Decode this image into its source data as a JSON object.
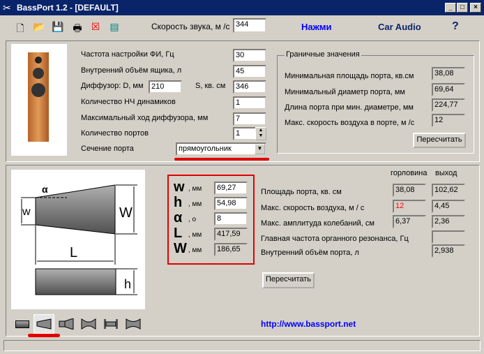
{
  "window": {
    "title": "BassPort 1.2 - [DEFAULT]"
  },
  "toolbar": {
    "sound_speed_label": "Скорость звука, м /с",
    "sound_speed_value": "344",
    "press_link": "Нажми",
    "car_audio_link": "Car Audio",
    "help": "?"
  },
  "top": {
    "rows": [
      {
        "label": "Частота настройки ФИ, Гц",
        "value": "30"
      },
      {
        "label": "Внутренний объём ящика, л",
        "value": "45"
      },
      {
        "label": "Диффузор: D, мм",
        "value": "346",
        "d_value": "210",
        "s_label": "S, кв. см"
      },
      {
        "label": "Количество НЧ динамиков",
        "value": "1"
      },
      {
        "label": "Максимальный ход диффузора, мм",
        "value": "7"
      },
      {
        "label": "Количество портов",
        "value": "1"
      }
    ],
    "section_label": "Сечение порта",
    "section_value": "прямоугольник",
    "limits": {
      "title": "Граничные значения",
      "rows": [
        {
          "label": "Минимальная площадь порта, кв.см",
          "value": "38,08"
        },
        {
          "label": "Минимальный диаметр порта, мм",
          "value": "69,64"
        },
        {
          "label": "Длина порта при мин. диаметре, мм",
          "value": "224,77"
        },
        {
          "label": "Макс. скорость воздуха в порте, м /с",
          "value": "12"
        }
      ],
      "recalc": "Пересчитать"
    }
  },
  "dims": [
    {
      "sym": "w",
      "unit": ", мм",
      "value": "69,27"
    },
    {
      "sym": "h",
      "unit": ", мм",
      "value": "54,98"
    },
    {
      "sym": "α",
      "unit": ", о",
      "value": "8"
    },
    {
      "sym": "L",
      "unit": ", мм",
      "value": "417,59"
    },
    {
      "sym": "W",
      "unit": ", мм",
      "value": "186,65"
    }
  ],
  "drawing": {
    "alpha": "α",
    "w": "w",
    "W": "W",
    "L": "L",
    "h": "h"
  },
  "results": {
    "col_throat": "горловина",
    "col_exit": "выход",
    "rows": [
      {
        "label": "Площадь порта, кв. см",
        "throat": "38,08",
        "exit": "102,62"
      },
      {
        "label": "Макс. скорость воздуха, м / с",
        "throat": "12",
        "exit": "4,45"
      },
      {
        "label": "Макс. амплитуда колебаний, см",
        "throat": "6,37",
        "exit": "2,36"
      },
      {
        "label": "Главная частота органного резонанса, Гц",
        "exit": ""
      },
      {
        "label": "Внутренний объём порта, л",
        "exit": "2,938"
      }
    ],
    "recalc": "Пересчитать",
    "warn_color": "#ff0000"
  },
  "link": "http://www.bassport.net",
  "colors": {
    "title_bar": "#0a246a",
    "highlight": "#e00000",
    "link": "#0000ff"
  }
}
